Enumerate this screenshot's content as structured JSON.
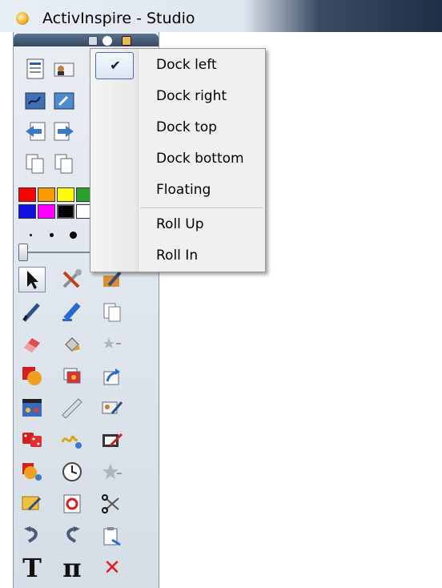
{
  "titlebar": {
    "title": "ActivInspire - Studio",
    "logo_icon": "activinspire-logo-icon"
  },
  "toolbox": {
    "header_buttons": [
      "toolbox-menu-icon",
      "pin-icon",
      "lock-icon"
    ],
    "colors": {
      "row1": [
        "#ff0000",
        "#ff9900",
        "#ffff00",
        "#2ca02c"
      ],
      "row2": [
        "#1010e0",
        "#ff00ff",
        "#000000",
        "#ffffff"
      ]
    },
    "pen_sizes": [
      "small",
      "medium",
      "large"
    ],
    "tools": [
      "select-arrow-icon",
      "tools-crossed-icon",
      "edit-pen-icon",
      "pen-icon",
      "highlighter-icon",
      "page-icon",
      "eraser-icon",
      "fill-bucket-icon",
      "favourite-star-icon",
      "shapes-icon",
      "pages-icon",
      "export-icon",
      "media-icon",
      "ruler-icon",
      "edit-profiles-icon",
      "dice-icon",
      "handwriting-recognition-icon",
      "page-editor-icon",
      "shape-recognition-icon",
      "clock-icon",
      "favourite-star-2-icon",
      "page-browser-icon",
      "reset-page-icon",
      "cut-icon",
      "undo-icon",
      "redo-icon",
      "clipboard-icon",
      "text-icon",
      "maths-pi-icon",
      "delete-icon"
    ],
    "text_tool_label": "T",
    "pi_tool_label": "π",
    "delete_label": "✕"
  },
  "menu": {
    "items": [
      {
        "label": "Dock left",
        "checked": true
      },
      {
        "label": "Dock right",
        "checked": false
      },
      {
        "label": "Dock top",
        "checked": false
      },
      {
        "label": "Dock bottom",
        "checked": false
      },
      {
        "label": "Floating",
        "checked": false
      },
      {
        "label": "Roll Up",
        "checked": false
      },
      {
        "label": "Roll In",
        "checked": false
      }
    ],
    "check_mark": "✔"
  }
}
